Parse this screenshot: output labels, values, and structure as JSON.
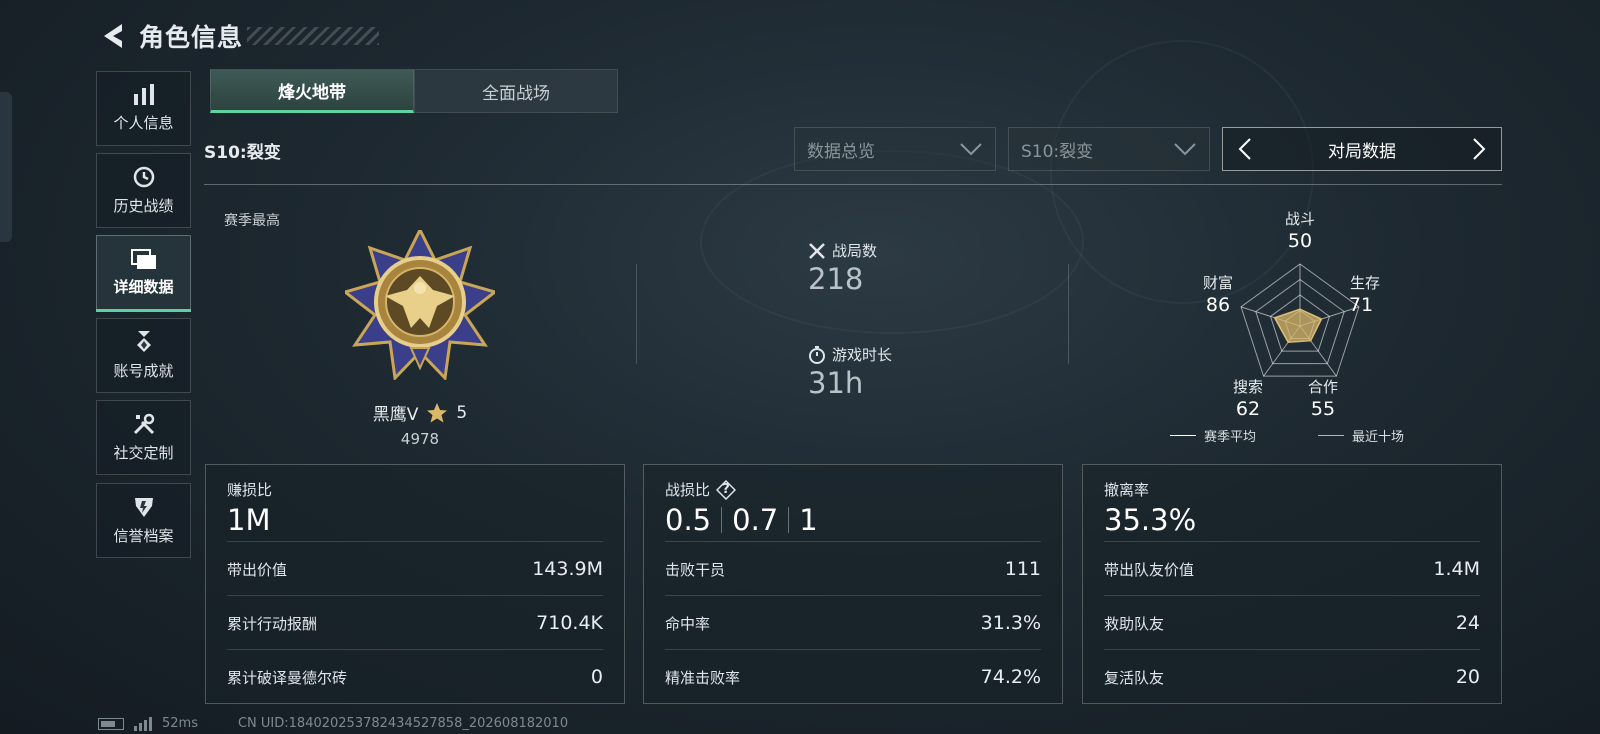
{
  "header": {
    "title": "角色信息"
  },
  "sidebar": {
    "items": [
      {
        "label": "个人信息",
        "icon": "bar-chart-icon"
      },
      {
        "label": "历史战绩",
        "icon": "history-icon"
      },
      {
        "label": "详细数据",
        "icon": "folder-icon",
        "active": true
      },
      {
        "label": "账号成就",
        "icon": "achievement-icon"
      },
      {
        "label": "社交定制",
        "icon": "tools-icon"
      },
      {
        "label": "信誉档案",
        "icon": "shield-icon"
      }
    ]
  },
  "tabs": [
    {
      "label": "烽火地带",
      "active": true
    },
    {
      "label": "全面战场",
      "active": false
    }
  ],
  "season_title": "S10:裂变",
  "filters": {
    "overview": "数据总览",
    "season": "S10:裂变",
    "nav_label": "对局数据"
  },
  "overview": {
    "season_high_label": "赛季最高",
    "rank_name": "黑鹰V",
    "rank_stars": "5",
    "rank_points": "4978",
    "matches_label": "战局数",
    "matches_value": "218",
    "playtime_label": "游戏时长",
    "playtime_value": "31h"
  },
  "radar": {
    "axes": [
      {
        "label": "战斗",
        "value": "50"
      },
      {
        "label": "生存",
        "value": "71"
      },
      {
        "label": "合作",
        "value": "55"
      },
      {
        "label": "搜索",
        "value": "62"
      },
      {
        "label": "财富",
        "value": "86"
      }
    ],
    "legend": {
      "season_avg": "赛季平均",
      "recent_ten": "最近十场"
    },
    "colors": {
      "season_avg": "#ffffff",
      "recent_ten": "#d9b86a"
    }
  },
  "cards": {
    "profit": {
      "title": "赚损比",
      "main": "1M",
      "rows": [
        {
          "label": "带出价值",
          "value": "143.9M"
        },
        {
          "label": "累计行动报酬",
          "value": "710.4K"
        },
        {
          "label": "累计破译曼德尔砖",
          "value": "0"
        }
      ]
    },
    "combat": {
      "title": "战损比",
      "help": "?",
      "main_values": [
        "0.5",
        "0.7",
        "1"
      ],
      "rows": [
        {
          "label": "击败干员",
          "value": "111"
        },
        {
          "label": "命中率",
          "value": "31.3%"
        },
        {
          "label": "精准击败率",
          "value": "74.2%"
        }
      ]
    },
    "extract": {
      "title": "撤离率",
      "main": "35.3%",
      "rows": [
        {
          "label": "带出队友价值",
          "value": "1.4M"
        },
        {
          "label": "救助队友",
          "value": "24"
        },
        {
          "label": "复活队友",
          "value": "20"
        }
      ]
    }
  },
  "footer": {
    "ping": "52ms",
    "uid": "CN UID:184020253782434527858_202608182010"
  },
  "colors": {
    "accent": "#5fd0a0",
    "gold": "#d9b86a"
  }
}
